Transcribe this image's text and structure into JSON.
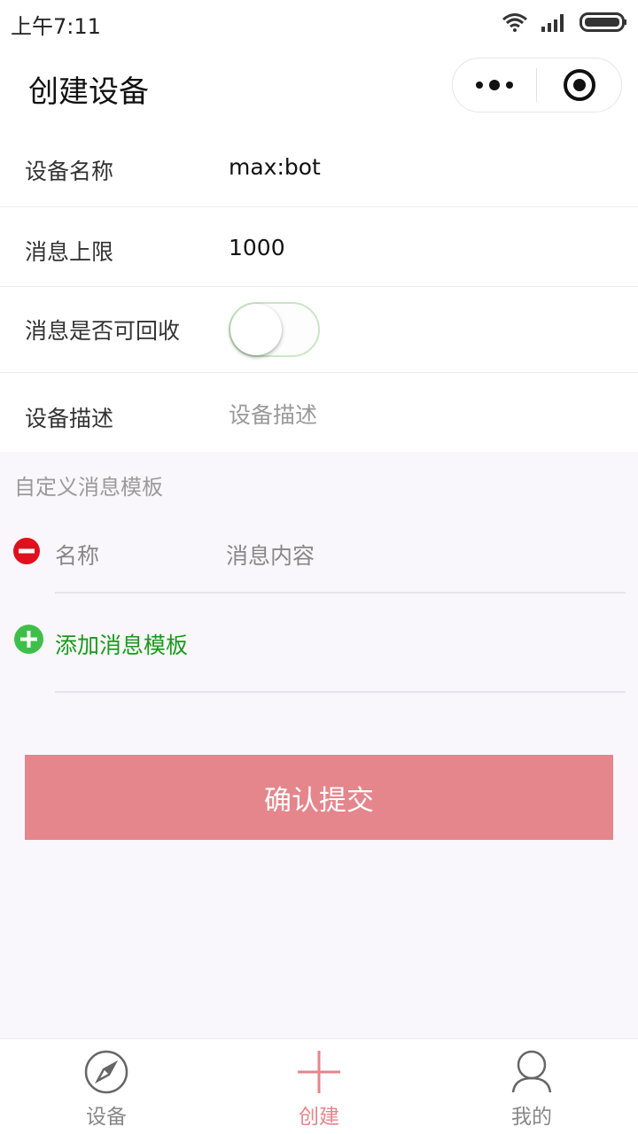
{
  "status_bar": {
    "time": "上午7:11",
    "icons": [
      "wifi-icon",
      "signal-icon",
      "battery-icon"
    ]
  },
  "nav": {
    "title": "创建设备",
    "capsule_icons": [
      "more-icon",
      "target-icon"
    ]
  },
  "form": {
    "name_label": "设备名称",
    "name_value": "max:bot",
    "limit_label": "消息上限",
    "limit_value": "1000",
    "recyclable_label": "消息是否可回收",
    "recyclable_on": false,
    "desc_label": "设备描述",
    "desc_placeholder": "设备描述"
  },
  "templates": {
    "section_title": "自定义消息模板",
    "name_placeholder": "名称",
    "content_placeholder": "消息内容",
    "add_label": "添加消息模板"
  },
  "submit_label": "确认提交",
  "tabbar": {
    "tabs": [
      {
        "label": "设备",
        "icon": "compass-icon",
        "active": false
      },
      {
        "label": "创建",
        "icon": "plus-icon",
        "active": true
      },
      {
        "label": "我的",
        "icon": "user-icon",
        "active": false
      }
    ]
  },
  "colors": {
    "accent": "#e5858c",
    "add_green": "#1a9a1a",
    "remove_red": "#e0101c",
    "background": "#f9f7fc"
  }
}
